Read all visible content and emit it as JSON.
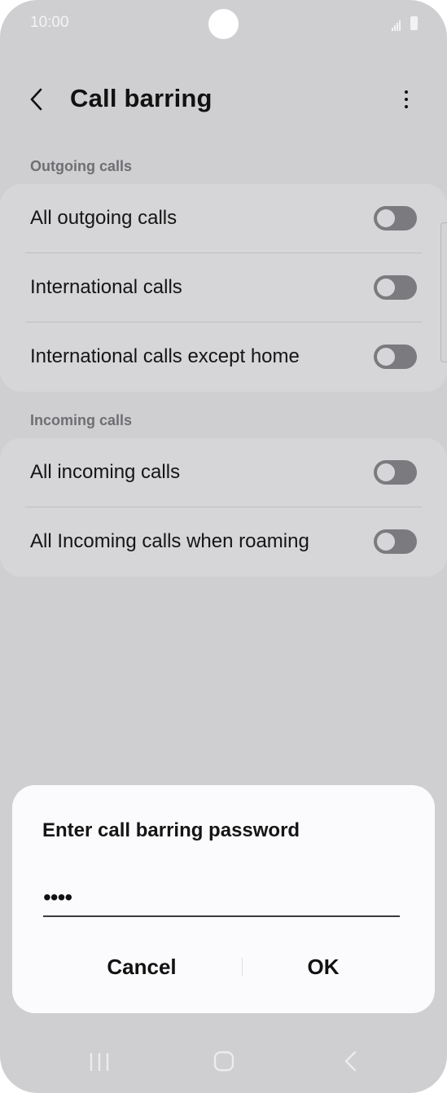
{
  "status_bar": {
    "time": "10:00"
  },
  "app_bar": {
    "title": "Call barring"
  },
  "sections": [
    {
      "header": "Outgoing calls",
      "items": [
        {
          "label": "All outgoing calls",
          "enabled": false
        },
        {
          "label": "International calls",
          "enabled": false
        },
        {
          "label": "International calls except home",
          "enabled": false
        }
      ]
    },
    {
      "header": "Incoming calls",
      "items": [
        {
          "label": "All incoming calls",
          "enabled": false
        },
        {
          "label": "All Incoming calls when roaming",
          "enabled": false
        }
      ]
    }
  ],
  "dialog": {
    "title": "Enter call barring password",
    "password_value": "••••",
    "cancel_label": "Cancel",
    "ok_label": "OK"
  },
  "nav_bar": {
    "icons": [
      "recent-apps-icon",
      "home-icon",
      "back-icon"
    ]
  },
  "colors": {
    "background": "#cfcfd1",
    "card": "#d6d6d8",
    "toggle_off": "#7b7b7f",
    "dialog": "#fbfbfd"
  }
}
